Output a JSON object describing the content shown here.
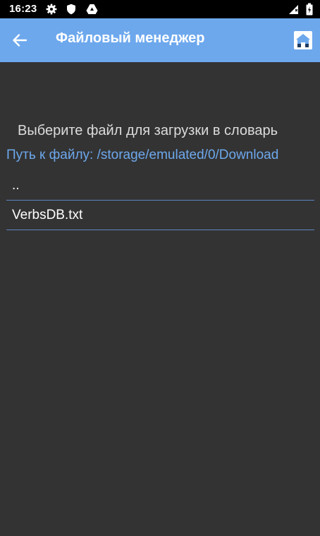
{
  "status_bar": {
    "time": "16:23",
    "left_icons": [
      "gear-icon",
      "shield-icon",
      "drive-icon"
    ],
    "right_icons": [
      "signal-icon",
      "battery-icon"
    ]
  },
  "app_bar": {
    "title": "Файловый менеджер",
    "back_icon": "arrow-left-icon",
    "home_icon": "home-icon",
    "color": "#6da8ed"
  },
  "main": {
    "prompt": "Выберите файл для загрузки в словарь",
    "path": "Путь к файлу: /storage/emulated/0/Download",
    "files": [
      {
        "label": ".."
      },
      {
        "label": "VerbsDB.txt"
      }
    ]
  },
  "colors": {
    "background": "#333333",
    "accent": "#6da8ed",
    "divider": "#5a86c2"
  }
}
